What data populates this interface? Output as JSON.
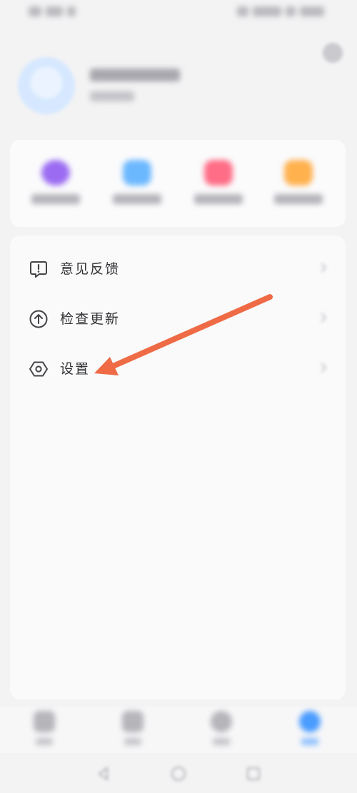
{
  "menu": {
    "items": [
      {
        "label": "意见反馈",
        "icon": "feedback-icon"
      },
      {
        "label": "检查更新",
        "icon": "update-arrow-icon"
      },
      {
        "label": "设置",
        "icon": "settings-hexagon-icon"
      }
    ]
  },
  "quick_actions": {
    "colors": [
      "#9b6cf2",
      "#6cb8ff",
      "#ff6d86",
      "#ffb14e"
    ],
    "icons": [
      "purple-circle-icon",
      "cloud-icon",
      "heart-icon",
      "folder-icon"
    ]
  },
  "bottom_nav": {
    "icons": [
      "home-icon",
      "video-icon",
      "discover-icon",
      "me-icon"
    ],
    "active_index": 3
  },
  "annotation": {
    "arrow_color": "#ee6b45"
  },
  "colors": {
    "accent_blue": "#4a9cff",
    "text": "#333336"
  }
}
